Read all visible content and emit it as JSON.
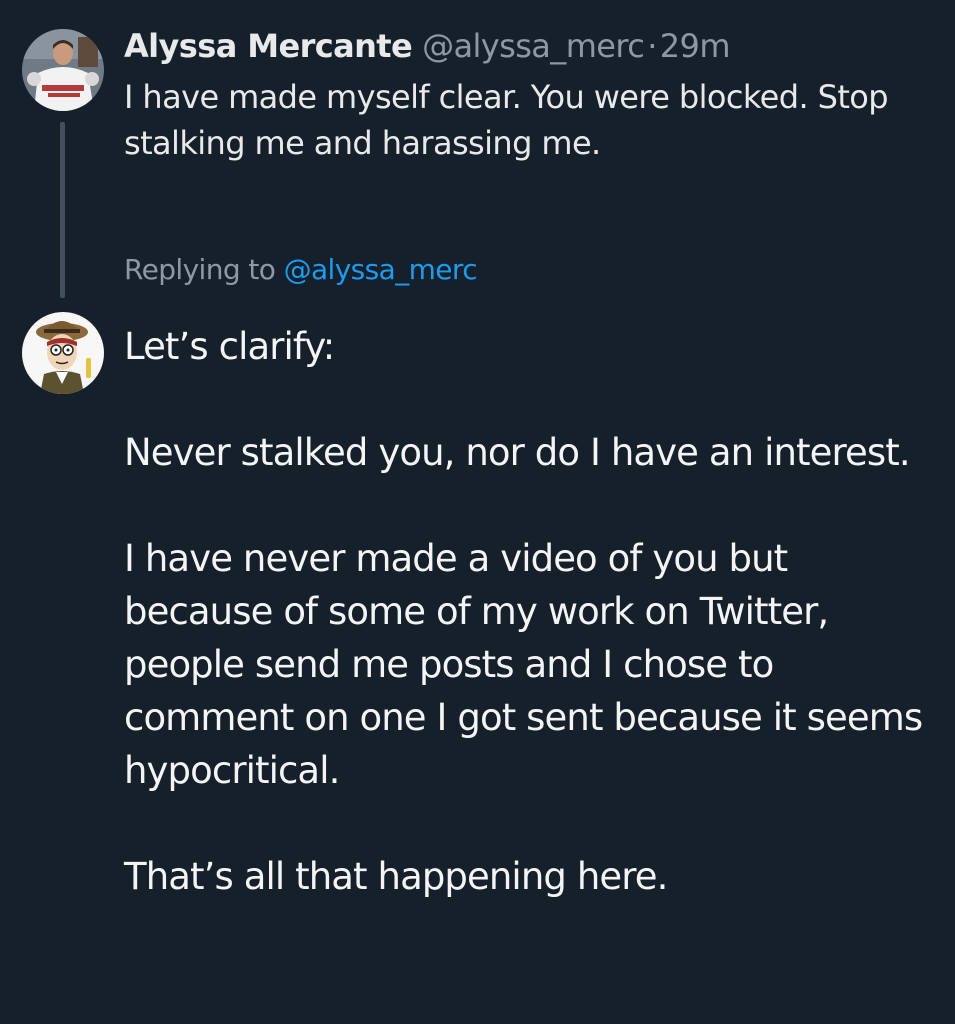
{
  "colors": {
    "background": "#15202b",
    "primary_text": "#e7e9ea",
    "secondary_text": "#8b98a5",
    "link": "#1d9bf0",
    "thread_line": "#42505d"
  },
  "original_tweet": {
    "display_name": "Alyssa Mercante",
    "handle": "@alyssa_merc",
    "separator": "·",
    "time": "29m",
    "text": "I have made myself clear. You were blocked. Stop stalking me and harassing me.",
    "avatar_icon": "user-photo-avatar"
  },
  "reply": {
    "replying_prefix": "Replying to",
    "replying_handle": "@alyssa_merc",
    "avatar_icon": "cartoon-character-avatar",
    "paragraphs": [
      "Let’s clarify:",
      "Never stalked you, nor do I have an interest.",
      "I have never made a video of you but because of some of my work on Twitter, people send me posts and I chose to comment on one I got sent because it seems hypocritical.",
      "That’s all that happening here."
    ]
  }
}
